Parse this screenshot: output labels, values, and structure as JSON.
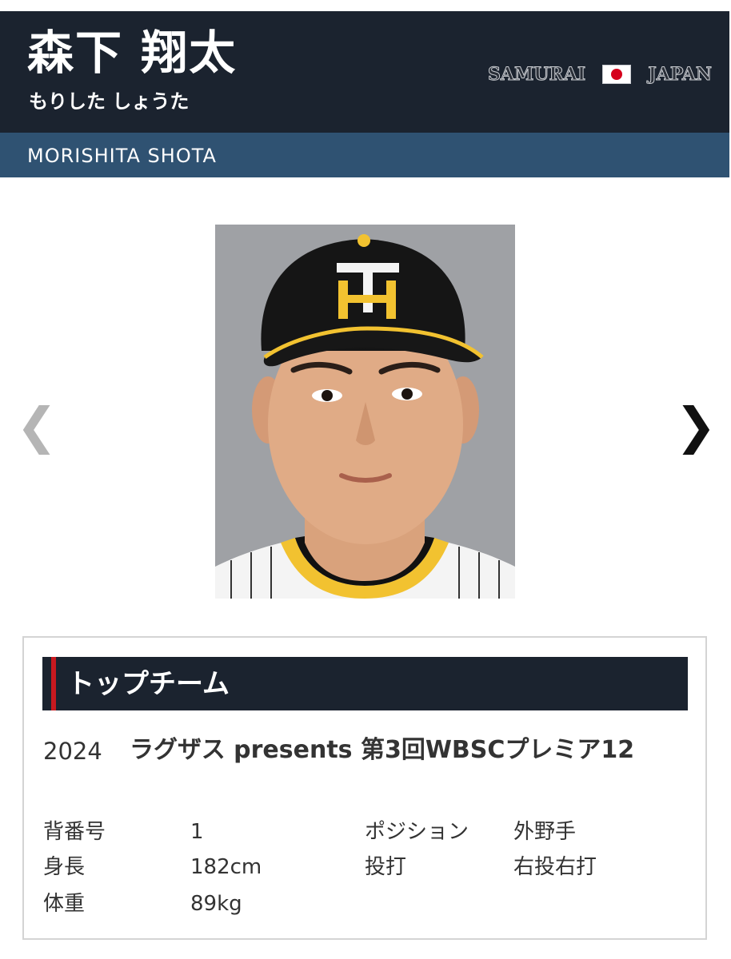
{
  "header": {
    "name": "森下 翔太",
    "kana": "もりした しょうた",
    "brand_left": "SAMURAI",
    "brand_right": "JAPAN"
  },
  "subheader": {
    "romaji": "MORISHITA SHOTA"
  },
  "carousel": {
    "prev_glyph": "❮",
    "next_glyph": "❯"
  },
  "profile": {
    "section_title": "トップチーム",
    "year": "2024",
    "event": "ラグザス presents 第3回WBSCプレミア12",
    "stats": {
      "number_label": "背番号",
      "number_value": "1",
      "position_label": "ポジション",
      "position_value": "外野手",
      "height_label": "身長",
      "height_value": "182cm",
      "bats_throws_label": "投打",
      "bats_throws_value": "右投右打",
      "weight_label": "体重",
      "weight_value": "89kg"
    }
  },
  "colors": {
    "header_bg": "#1b232f",
    "subheader_bg": "#2f5272",
    "accent_red": "#c8191f",
    "flag_red": "#d5001c",
    "cap_yellow": "#f2c230"
  }
}
